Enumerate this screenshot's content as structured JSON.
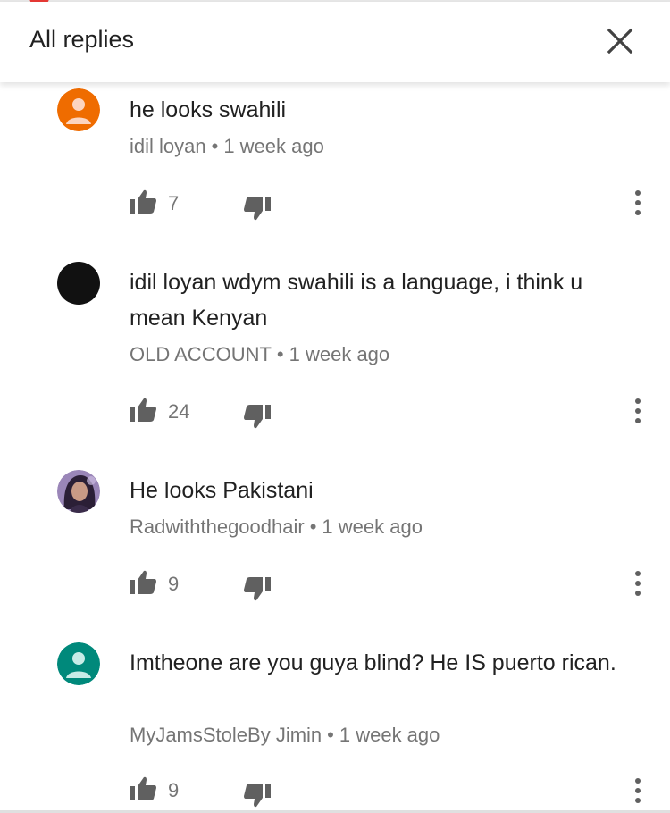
{
  "header": {
    "title": "All replies",
    "close_icon": "close-icon"
  },
  "colors": {
    "notification_dot": "#e53935",
    "avatar_orange": "#ef6c00",
    "avatar_black": "#111111",
    "avatar_teal": "#00897b",
    "text_primary": "#212121",
    "text_secondary": "#757575"
  },
  "comments": [
    {
      "text": "he looks swahili",
      "author": "idil loyan",
      "separator": "•",
      "time": "1 week ago",
      "likes": "7",
      "avatar": "default-user-orange"
    },
    {
      "text": "idil loyan wdym swahili is a language, i think u mean Kenyan",
      "author": "OLD ACCOUNT",
      "separator": "•",
      "time": "1 week ago",
      "likes": "24",
      "avatar": "black-circle"
    },
    {
      "text": "He looks Pakistani",
      "author": "Radwiththegoodhair",
      "separator": "•",
      "time": "1 week ago",
      "likes": "9",
      "avatar": "profile-photo"
    },
    {
      "text": "Imtheone are you guya blind? He IS puerto rican.",
      "author": "MyJamsStoleBy Jimin",
      "separator": "•",
      "time": "1 week ago",
      "likes": "9",
      "avatar": "default-user-teal"
    }
  ]
}
